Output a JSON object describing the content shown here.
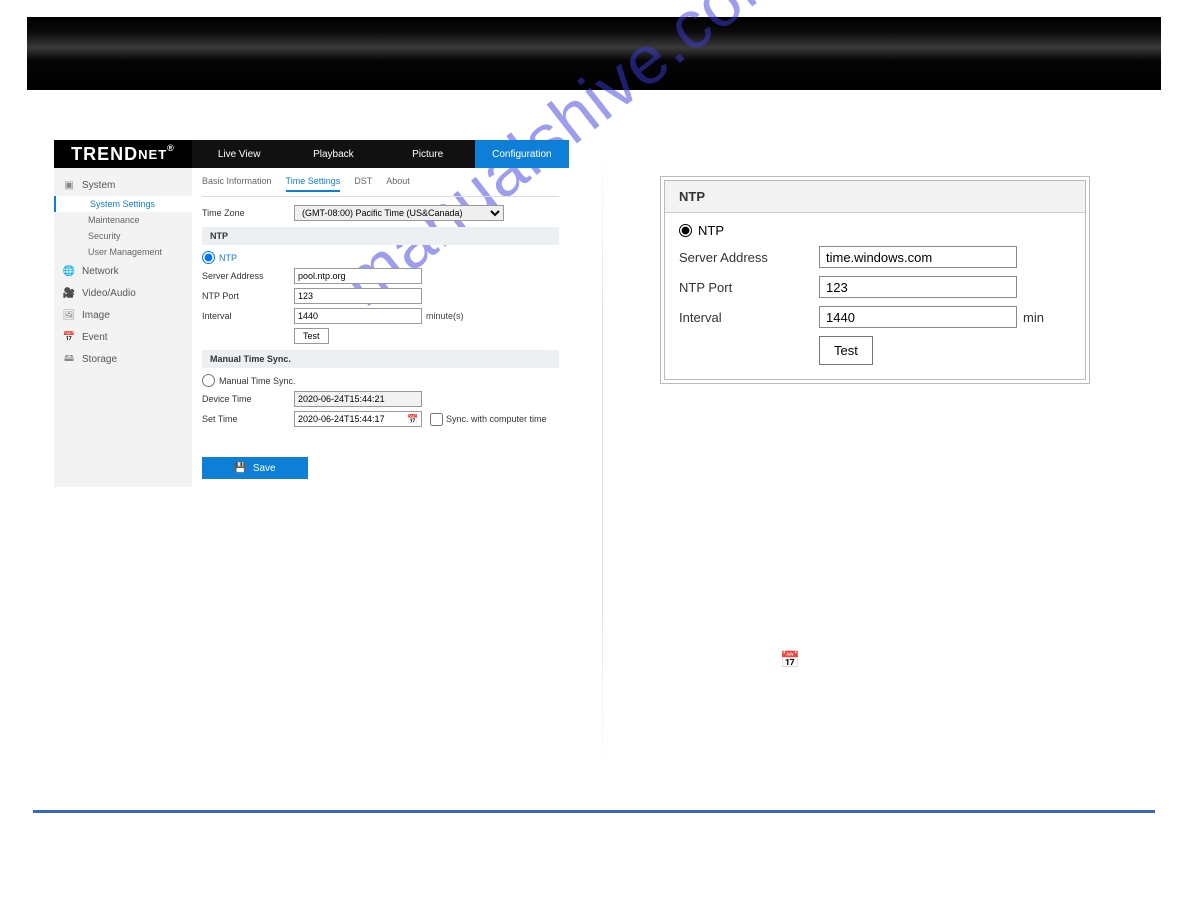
{
  "watermark": "manualshive.com",
  "logo": "TRENDNET",
  "topnav": {
    "live": "Live View",
    "playback": "Playback",
    "picture": "Picture",
    "config": "Configuration"
  },
  "sidebar": {
    "system": "System",
    "system_items": {
      "settings": "System Settings",
      "maintenance": "Maintenance",
      "security": "Security",
      "usermgmt": "User Management"
    },
    "network": "Network",
    "videoaudio": "Video/Audio",
    "image": "Image",
    "event": "Event",
    "storage": "Storage"
  },
  "subtabs": {
    "basic": "Basic Information",
    "time": "Time Settings",
    "dst": "DST",
    "about": "About"
  },
  "form": {
    "timezone_label": "Time Zone",
    "timezone_value": "(GMT-08:00) Pacific Time (US&Canada)",
    "ntp_header": "NTP",
    "ntp_radio": "NTP",
    "server_label": "Server Address",
    "server_value": "pool.ntp.org",
    "port_label": "NTP Port",
    "port_value": "123",
    "interval_label": "Interval",
    "interval_value": "1440",
    "interval_unit": "minute(s)",
    "test_btn": "Test",
    "manual_header": "Manual Time Sync.",
    "manual_radio": "Manual Time Sync.",
    "device_time_label": "Device Time",
    "device_time_value": "2020-06-24T15:44:21",
    "set_time_label": "Set Time",
    "set_time_value": "2020-06-24T15:44:17",
    "sync_checkbox": "Sync. with computer time",
    "save_btn": "Save"
  },
  "panel": {
    "title": "NTP",
    "radio": "NTP",
    "server_label": "Server Address",
    "server_value": "time.windows.com",
    "port_label": "NTP Port",
    "port_value": "123",
    "interval_label": "Interval",
    "interval_value": "1440",
    "interval_unit": "min",
    "test_btn": "Test"
  }
}
